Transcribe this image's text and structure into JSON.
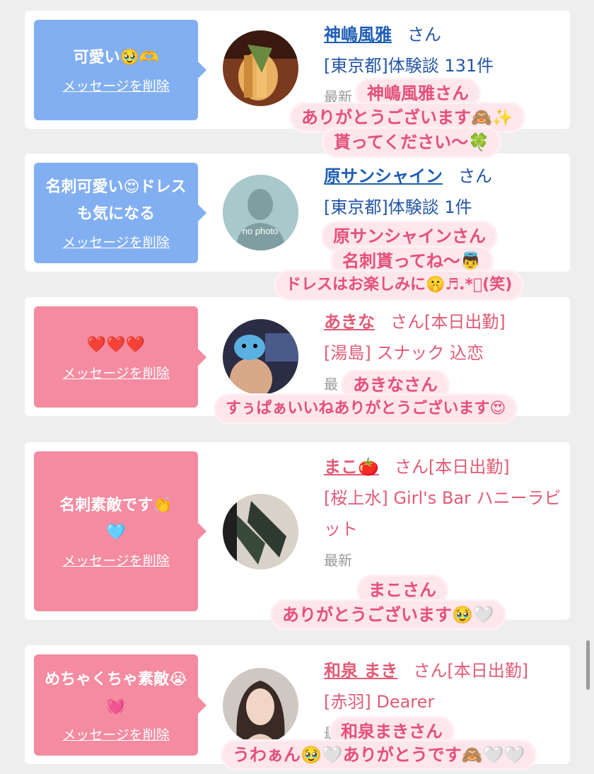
{
  "delete_label": "メッセージを削除",
  "san": "さん",
  "cards": [
    {
      "message": "可愛い🥹🫶",
      "name": "神嶋風雅",
      "name_suffix": "さん",
      "shop": "[東京都]体験談 131件",
      "meta": "最新",
      "sticker_lines": [
        "神嶋風雅さん",
        "ありがとうございます🙈✨",
        "貰ってください〜🍀"
      ]
    },
    {
      "message": "名刺可愛い😍ドレスも気になる",
      "name": "原サンシャイン",
      "name_suffix": "さん",
      "avatar_text": "no photo",
      "shop": "[東京都]体験談 1件",
      "meta": "最",
      "sticker_lines": [
        "原サンシャインさん",
        "名刺貰ってね〜👼",
        "ドレスはお楽しみに🤫♬.*ﾟ(笑)"
      ]
    },
    {
      "message": "❤️❤️❤️",
      "name": "あきな",
      "name_suffix": "さん[本日出勤]",
      "shop": "[湯島] スナック 込恋",
      "meta": "最",
      "sticker_lines": [
        "あきなさん",
        "すぅぱぁいいねありがとうございます😍"
      ]
    },
    {
      "message": "名刺素敵です👏🩵",
      "name": "まこ🍅",
      "name_suffix": "さん[本日出勤]",
      "shop": "[桜上水] Girl's Bar ハニーラビット",
      "meta": "最新",
      "sticker_lines": [
        "まこさん",
        "ありがとうございます🥹🤍"
      ]
    },
    {
      "message": "めちゃくちゃ素敵😭💓",
      "name": "和泉 まき",
      "name_suffix": "さん[本日出勤]",
      "shop": "[赤羽] Dearer",
      "meta": "最",
      "sticker_lines": [
        "和泉まきさん",
        "うわぁん🥹🤍ありがとうです🙈🤍🤍"
      ]
    }
  ]
}
